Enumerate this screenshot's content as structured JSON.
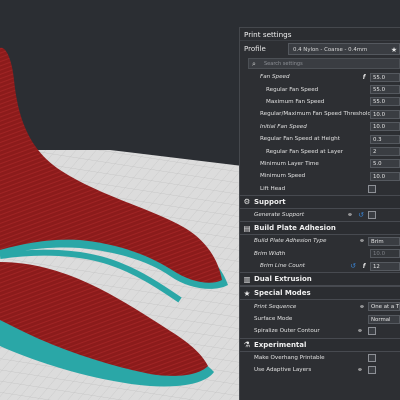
{
  "panel": {
    "title": "Print settings",
    "profile_label": "Profile",
    "profile_value": "0.4 Nylon - Coarse - 0.4mm",
    "search_placeholder": "Search settings"
  },
  "rows_top": [
    {
      "label": "Fan Speed",
      "value": "55.0",
      "italic": true,
      "indent": "ind1",
      "fx": true
    },
    {
      "label": "Regular Fan Speed",
      "value": "55.0",
      "indent": "ind2"
    },
    {
      "label": "Maximum Fan Speed",
      "value": "55.0",
      "indent": "ind2"
    },
    {
      "label": "Regular/Maximum Fan Speed Threshold",
      "value": "10.0",
      "indent": "ind1"
    },
    {
      "label": "Initial Fan Speed",
      "value": "10.0",
      "italic": true,
      "indent": "ind1"
    },
    {
      "label": "Regular Fan Speed at Height",
      "value": "0.3",
      "indent": "ind1"
    },
    {
      "label": "Regular Fan Speed at Layer",
      "value": "2",
      "indent": "ind2"
    },
    {
      "label": "Minimum Layer Time",
      "value": "5.0",
      "indent": "ind1"
    },
    {
      "label": "Minimum Speed",
      "value": "10.0",
      "indent": "ind1"
    },
    {
      "label": "Lift Head",
      "indent": "ind1"
    }
  ],
  "sections": {
    "support": "Support",
    "adhesion": "Build Plate Adhesion",
    "dual": "Dual Extrusion",
    "special": "Special Modes",
    "experimental": "Experimental"
  },
  "support_rows": [
    {
      "label": "Generate Support"
    }
  ],
  "adhesion_rows": [
    {
      "label": "Build Plate Adhesion Type",
      "value": "Brim"
    },
    {
      "label": "Brim Width",
      "value": "10.0"
    },
    {
      "label": "Brim Line Count",
      "value": "12"
    }
  ],
  "special_rows": [
    {
      "label": "Print Sequence",
      "value": "One at a Time"
    },
    {
      "label": "Surface Mode",
      "value": "Normal"
    },
    {
      "label": "Spiralize Outer Contour"
    }
  ],
  "experimental_rows": [
    {
      "label": "Make Overhang Printable"
    },
    {
      "label": "Use Adaptive Layers"
    }
  ],
  "colors": {
    "model": "#8b1a1a",
    "brim": "#2aa7a7",
    "build_plate": "#d7d7d7",
    "accent": "#3a85d6"
  }
}
